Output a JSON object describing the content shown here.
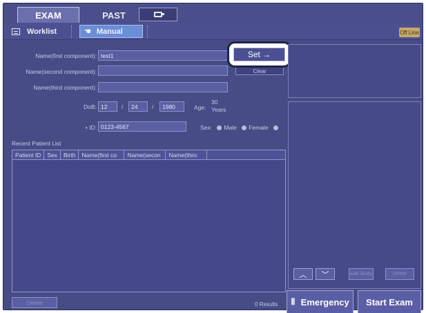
{
  "tabs": {
    "exam": "EXAM",
    "past": "PAST"
  },
  "subtabs": {
    "worklist": "Worklist",
    "manual": "Manual"
  },
  "status": {
    "offline": "Off Line"
  },
  "form": {
    "name_first_label": "Name(first component):",
    "name_first_value": "test1",
    "name_second_label": "Name(second component):",
    "name_second_value": "",
    "name_third_label": "Name(third component):",
    "name_third_value": "",
    "dob_label": "DoB:",
    "dob_month": "12",
    "dob_day": "24",
    "dob_year": "1980",
    "dob_sep": "/",
    "age_label": "Age:",
    "age_value": "30",
    "age_unit": "Years",
    "id_label": "• ID:",
    "id_value": "0123-4567",
    "sex_label": "Sex:",
    "sex_male": "Male",
    "sex_female": "Female"
  },
  "buttons": {
    "set": "Set →",
    "clear": "Clear",
    "delete": "Delete",
    "add_study": "Add Study",
    "delete_right": "Delete",
    "emergency": "Emergency",
    "start_exam": "Start Exam"
  },
  "patient_list": {
    "title": "Recent Patient List",
    "columns": [
      "Patient ID",
      "Sex",
      "Birth",
      "Name(first co",
      "Name(secon",
      "Name(thirc"
    ],
    "results": "0 Results"
  },
  "icons": {
    "up": "up-arrow-icon",
    "down": "down-arrow-icon",
    "monitor": "monitor-icon",
    "worklist": "list-icon",
    "manual": "hand-icon",
    "emergency": "emergency-icon"
  }
}
